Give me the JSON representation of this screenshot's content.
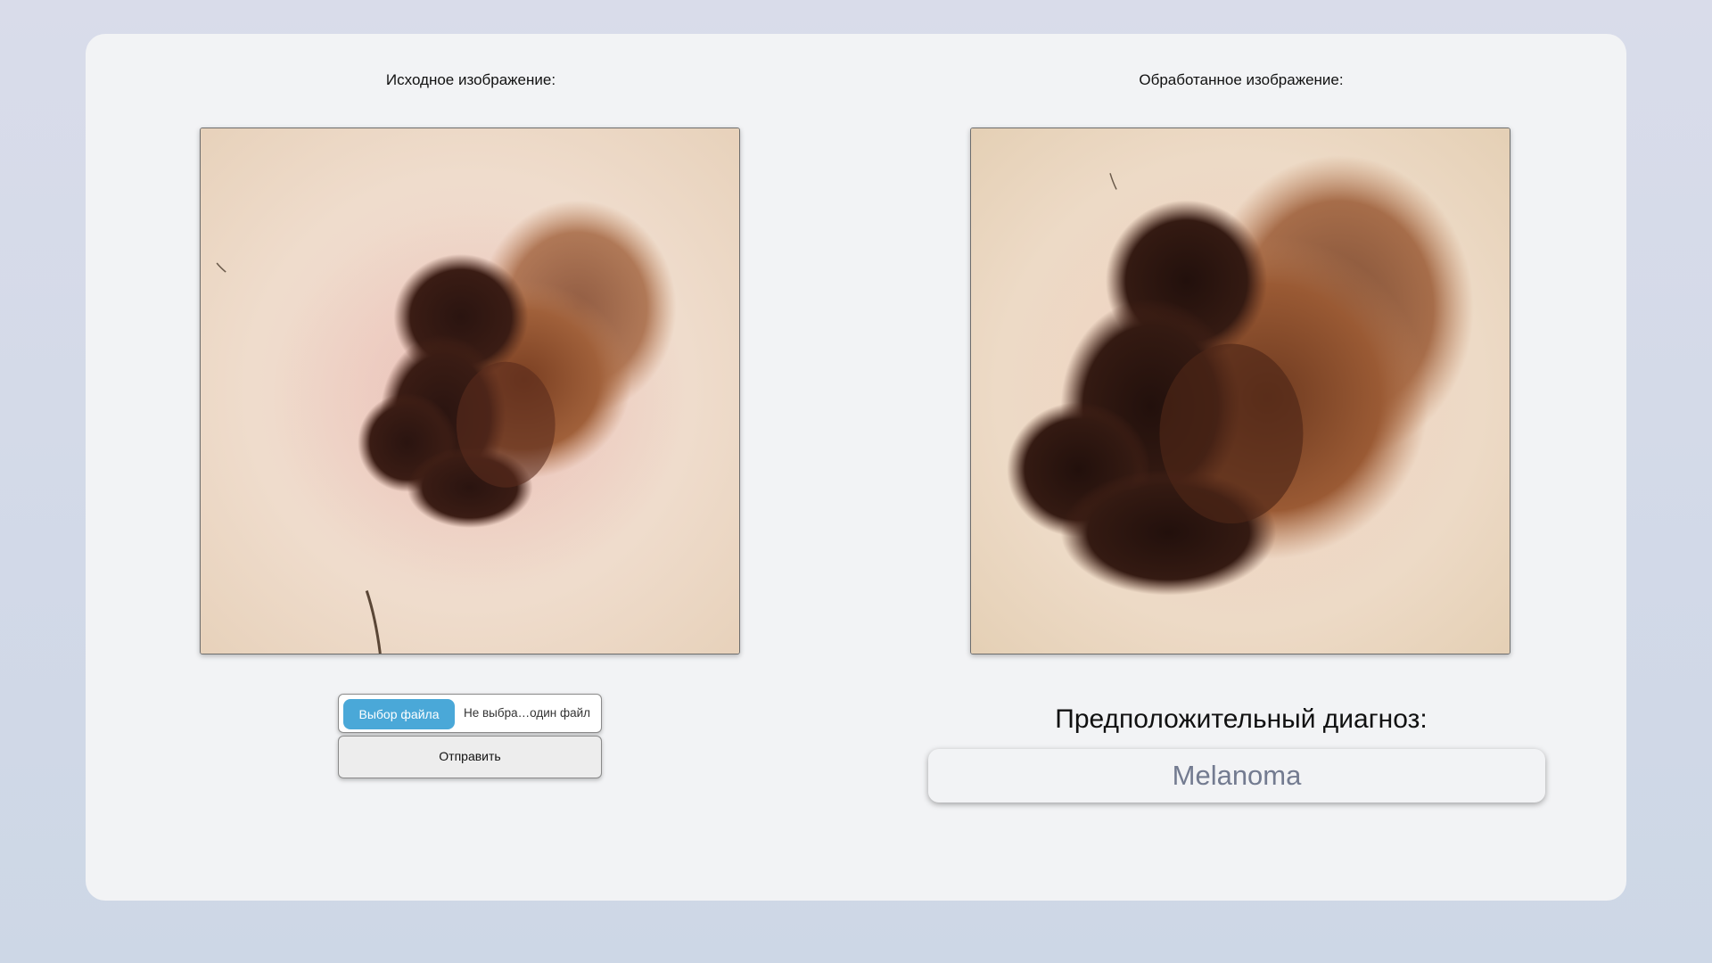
{
  "left_panel": {
    "title": "Исходное изображение:",
    "image_icon": "dermoscopy-lesion-image",
    "file_button_label": "Выбор файла",
    "file_name_text": "Не выбра…один файл",
    "submit_label": "Отправить"
  },
  "right_panel": {
    "title": "Обработанное изображение:",
    "image_icon": "processed-lesion-image",
    "diagnosis_label": "Предположительный диагноз:",
    "diagnosis_value": "Melanoma"
  },
  "colors": {
    "background": "#d9dcea",
    "card": "#f2f3f5",
    "file_button": "#4aa8d8",
    "diagnosis_text": "#737b90"
  }
}
